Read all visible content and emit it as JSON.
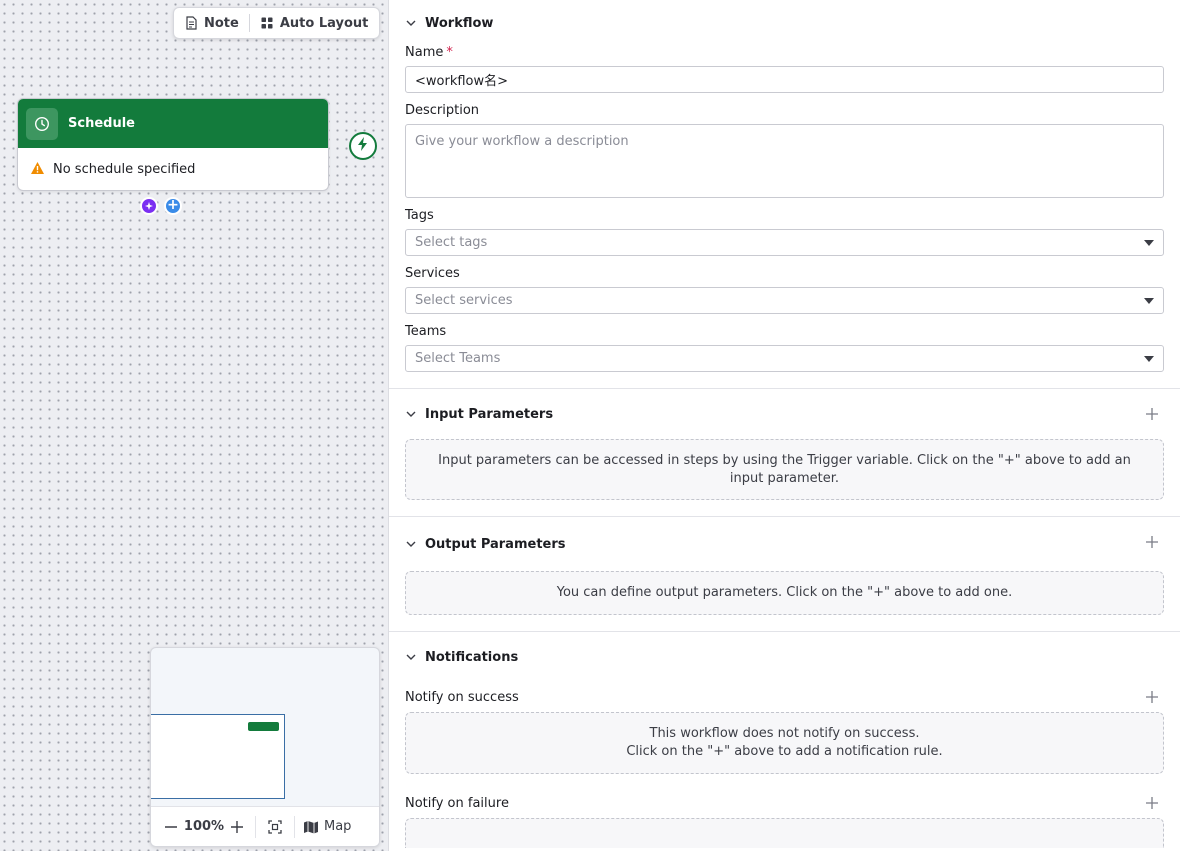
{
  "canvas": {
    "toolbar": {
      "note_label": "Note",
      "auto_layout_label": "Auto Layout"
    },
    "node": {
      "title": "Schedule",
      "warning": "No schedule specified"
    },
    "minimap": {
      "zoom": "100%",
      "map_label": "Map"
    }
  },
  "panel": {
    "workflow": {
      "title": "Workflow",
      "name_label": "Name",
      "name_required": "*",
      "name_value": "<workflow名>",
      "description_label": "Description",
      "description_placeholder": "Give your workflow a description",
      "tags_label": "Tags",
      "tags_placeholder": "Select tags",
      "services_label": "Services",
      "services_placeholder": "Select services",
      "teams_label": "Teams",
      "teams_placeholder": "Select Teams"
    },
    "input_params": {
      "title": "Input Parameters",
      "empty_text": "Input parameters can be accessed in steps by using the Trigger variable. Click on the \"+\" above to add an input parameter."
    },
    "output_params": {
      "title": "Output Parameters",
      "empty_text": "You can define output parameters. Click on the \"+\" above to add one."
    },
    "notifications": {
      "title": "Notifications",
      "success_label": "Notify on success",
      "success_empty_line1": "This workflow does not notify on success.",
      "success_empty_line2": "Click on the \"+\" above to add a notification rule.",
      "failure_label": "Notify on failure"
    }
  },
  "colors": {
    "node_green": "#137b3c",
    "accent_blue": "#3a8be8",
    "accent_purple": "#7b2ff2",
    "required_red": "#d0214c"
  }
}
